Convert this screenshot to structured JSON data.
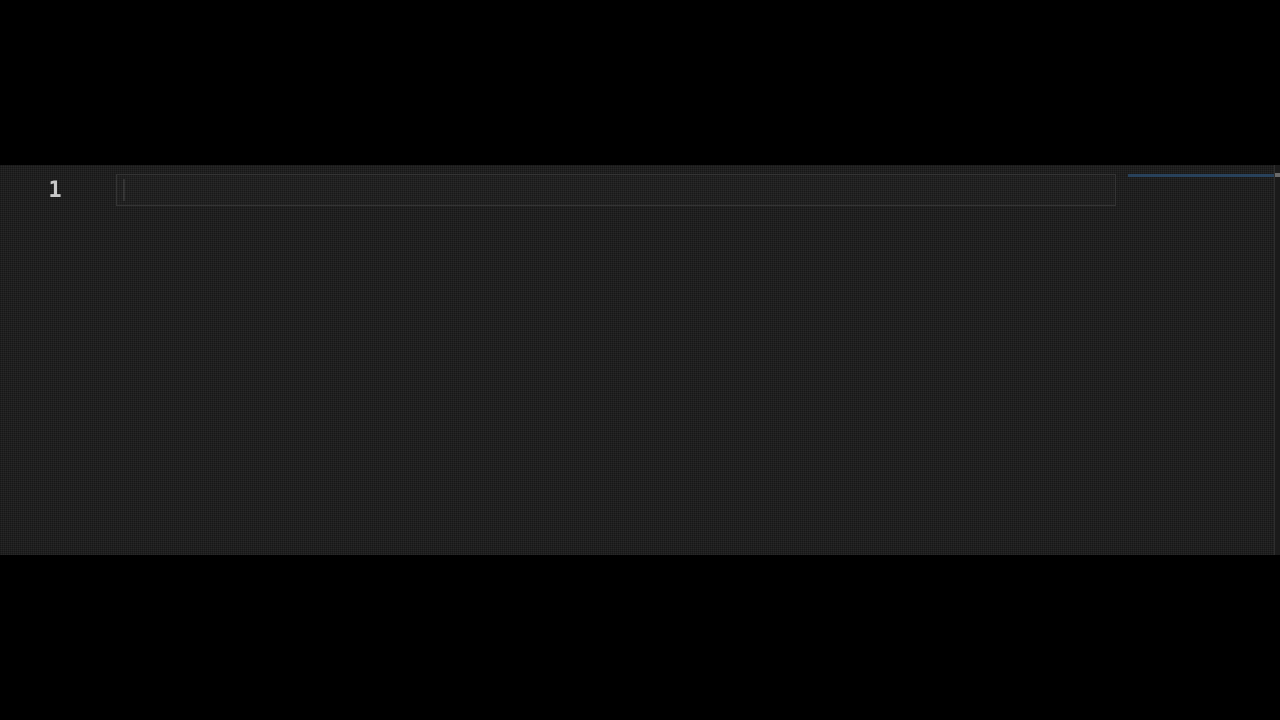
{
  "editor": {
    "line_numbers": [
      "1"
    ],
    "lines": [
      ""
    ]
  },
  "colors": {
    "background": "#1f1f1f",
    "letterbox": "#000000",
    "line_number": "#c8c8c8",
    "current_line_border": "#343434",
    "minimap_accent": "#2a4a6a"
  }
}
